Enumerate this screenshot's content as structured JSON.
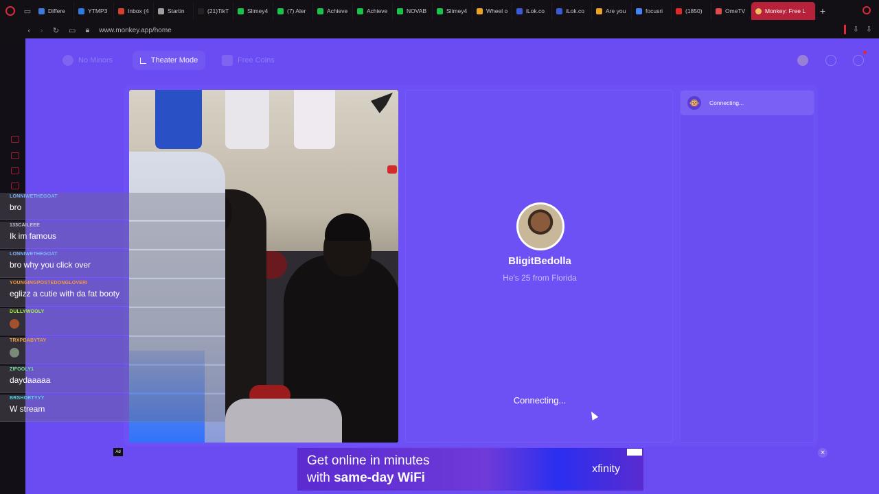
{
  "browser": {
    "tabs": [
      {
        "label": "Differe",
        "color": "#3d7bd6"
      },
      {
        "label": "YTMP3",
        "color": "#2d7be0"
      },
      {
        "label": "Inbox (4",
        "color": "#d6402f"
      },
      {
        "label": "Startin",
        "color": "#9f9f9f"
      },
      {
        "label": "(21)TikT",
        "color": "#222222"
      },
      {
        "label": "Slimey4",
        "color": "#19c34a"
      },
      {
        "label": "(7) Aler",
        "color": "#19c34a"
      },
      {
        "label": "Achieve",
        "color": "#19c34a"
      },
      {
        "label": "Achieve",
        "color": "#19c34a"
      },
      {
        "label": "NOVAB",
        "color": "#19c34a"
      },
      {
        "label": "Slimey4",
        "color": "#19c34a"
      },
      {
        "label": "Wheel o",
        "color": "#e8a325"
      },
      {
        "label": "iLok.co",
        "color": "#3a5bd6"
      },
      {
        "label": "iLok.co",
        "color": "#3a5bd6"
      },
      {
        "label": "Are you",
        "color": "#e8a325"
      },
      {
        "label": "focusri",
        "color": "#4285f4"
      },
      {
        "label": "(1850)",
        "color": "#e02a2a"
      },
      {
        "label": "OmeTV",
        "color": "#e04a4a"
      }
    ],
    "active_tab": "Monkey: Free L",
    "url": "www.monkey.app/home"
  },
  "topbar": {
    "no_minors": "No Minors",
    "theater_mode": "Theater Mode",
    "free_coins": "Free Coins"
  },
  "chat": [
    {
      "user": "LONNIWETHEGOAT",
      "text": "bro",
      "color": "#7fb2ff"
    },
    {
      "user": "133CAILEEE",
      "text": "Ik im famous",
      "color": "#c7c7d0"
    },
    {
      "user": "LONNIWETHEGOAT",
      "text": "bro why you click over",
      "color": "#7fb2ff"
    },
    {
      "user": "YOUNGINGPOSTEDONGLOVERI",
      "text": "eglizz a cutie with da fat booty",
      "color": "#f29a3a"
    },
    {
      "user": "DULLYWOOLY",
      "text": "",
      "color": "#9ef03a"
    },
    {
      "user": "TRXPBABYTAY",
      "text": "",
      "color": "#f2a03a"
    },
    {
      "user": "ZIFOOLY1",
      "text": "daydaaaaa",
      "color": "#6fe39a"
    },
    {
      "user": "BRSHORTYYY",
      "text": "W stream",
      "color": "#4fd7e8"
    }
  ],
  "match": {
    "name": "BligitBedolla",
    "subtitle": "He's 25 from Florida",
    "status": "Connecting..."
  },
  "right_panel": {
    "status": "Connecting..."
  },
  "ad": {
    "tag": "Ad",
    "line1": "Get online in minutes",
    "line2_prefix": "with ",
    "line2_bold": "same-day WiFi",
    "brand": "xfinity",
    "close": "×"
  }
}
